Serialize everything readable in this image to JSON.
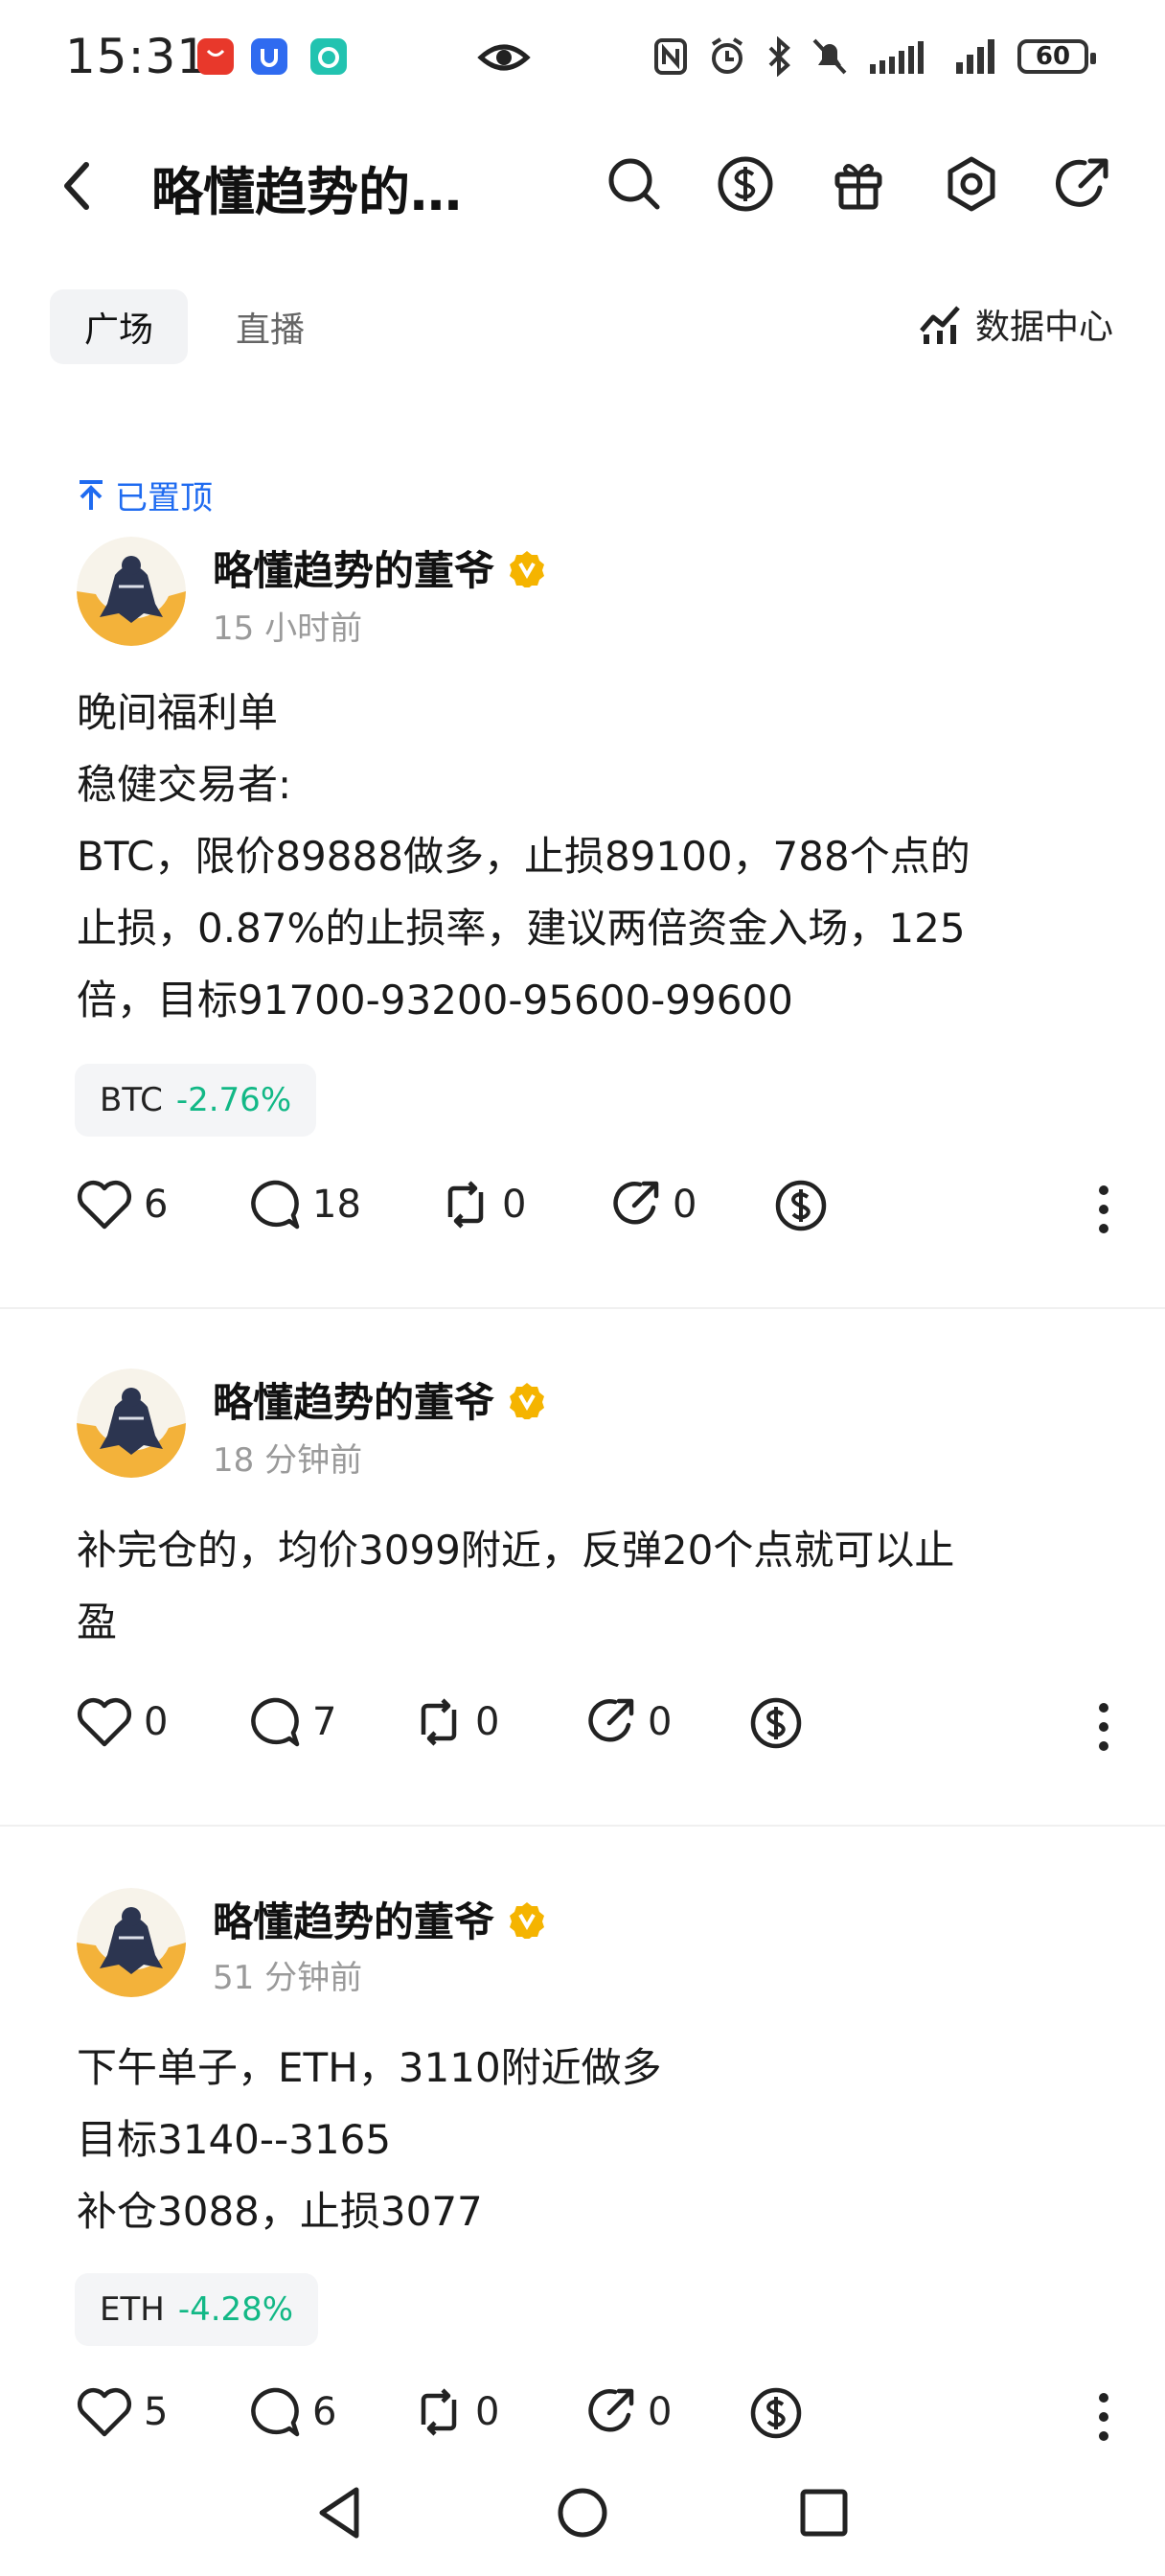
{
  "status_bar": {
    "time": "15:31",
    "battery": "60",
    "app_badges": [
      {
        "name": "huawei-store-icon",
        "color": "#e8382b",
        "label": "HUAWEI"
      },
      {
        "name": "app-u-icon",
        "color": "#2f6bf0"
      },
      {
        "name": "app-b-icon",
        "color": "#22c3b0"
      }
    ]
  },
  "header": {
    "title": "略懂趋势的…",
    "icons": [
      "search-icon",
      "dollar-icon",
      "gift-icon",
      "settings-icon",
      "share-icon"
    ]
  },
  "tabs": {
    "items": [
      {
        "label": "广场",
        "active": true
      },
      {
        "label": "直播",
        "active": false
      }
    ],
    "data_center": "数据中心"
  },
  "pinned_label": "已置顶",
  "posts": [
    {
      "author": "略懂趋势的董爷",
      "time": "15 小时前",
      "lines": [
        "晚间福利单",
        "稳健交易者:",
        "BTC，限价89888做多，止损89100，788个点的",
        "止损，0.87%的止损率，建议两倍资金入场，125",
        "倍，目标91700-93200-95600-99600"
      ],
      "tag": {
        "symbol": "BTC",
        "change": "-2.76%"
      },
      "likes": "6",
      "comments": "18",
      "reposts": "0",
      "shares": "0"
    },
    {
      "author": "略懂趋势的董爷",
      "time": "18 分钟前",
      "lines": [
        "补完仓的，均价3099附近，反弹20个点就可以止",
        "盈"
      ],
      "likes": "0",
      "comments": "7",
      "reposts": "0",
      "shares": "0"
    },
    {
      "author": "略懂趋势的董爷",
      "time": "51 分钟前",
      "lines": [
        "下午单子，ETH，3110附近做多",
        "目标3140--3165",
        "补仓3088，止损3077"
      ],
      "tag": {
        "symbol": "ETH",
        "change": "-4.28%"
      },
      "likes": "5",
      "comments": "6",
      "reposts": "0",
      "shares": "0"
    }
  ],
  "colors": {
    "accent_blue": "#1f6bf0",
    "verified_gold": "#f5b400",
    "negative_change": "#12b886"
  }
}
